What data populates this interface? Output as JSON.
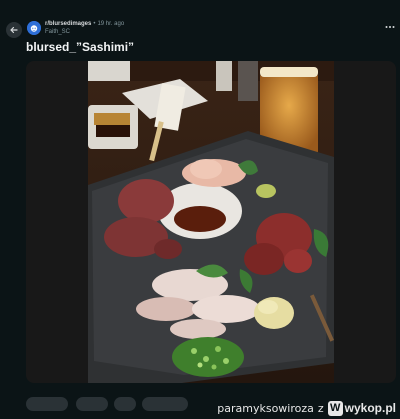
{
  "post": {
    "subreddit": "r/blursedimages",
    "separator": "•",
    "time": "19 hr. ago",
    "author": "Faith_SC",
    "title": "blursed_”Sashimi”"
  },
  "media": {
    "alt": "Plate of assorted raw sashimi with soy sauce, ginger, wasabi and green onions on a dark stone plate"
  },
  "icons": {
    "back": "arrow-left-icon",
    "more": "ellipsis-icon",
    "avatar": "subreddit-avatar-icon"
  },
  "watermark": {
    "user": "paramyksowiroza",
    "z": "z",
    "badge": "W",
    "site": "wykop.pl"
  },
  "colors": {
    "background": "#0b1416",
    "text": "#f2f4f5",
    "muted": "#82959b",
    "accent": "#2e6fd8"
  }
}
